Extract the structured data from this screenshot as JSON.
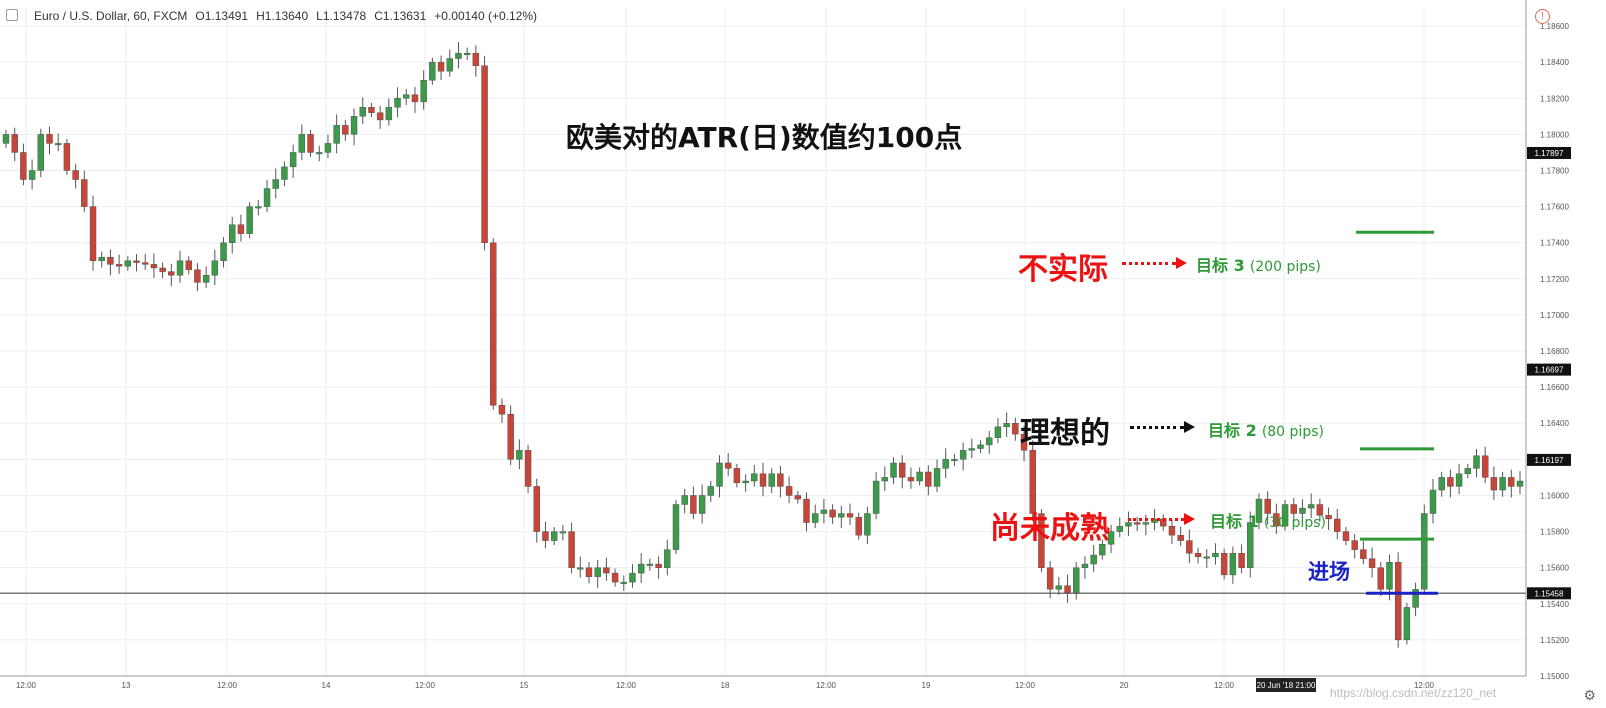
{
  "header": {
    "symbol": "Euro / U.S. Dollar, 60, FXCM",
    "ohlc": [
      "O1.13491",
      "H1.13640",
      "L1.13478",
      "C1.13631",
      "+0.00140 (+0.12%)"
    ]
  },
  "annotations": {
    "title": "欧美对的ATR(日)数值约100点",
    "unrealistic": "不实际",
    "ideal": "理想的",
    "premature": "尚未成熟",
    "entry": "进场",
    "target3_label": "目标 3",
    "target3_pips": "(200 pips)",
    "target2_label": "目标 2",
    "target2_pips": "(80 pips)",
    "target1_label": "目标 1",
    "target1_pips": "(30 pips)"
  },
  "watermark": "https://blog.csdn.net/zz120_net",
  "colors": {
    "up": "#3d9a4a",
    "down": "#c6463a",
    "target": "#2e9a36",
    "entry": "#1a22c4",
    "red_text": "#ee1111"
  },
  "chart_data": {
    "type": "candlestick",
    "ylim": [
      1.15,
      1.187
    ],
    "y_ticks": [
      "1.18600",
      "1.18400",
      "1.18200",
      "1.18000",
      "1.17800",
      "1.17600",
      "1.17400",
      "1.17200",
      "1.17000",
      "1.16800",
      "1.16600",
      "1.16400",
      "1.16200",
      "1.16000",
      "1.15800",
      "1.15600",
      "1.15400",
      "1.15200",
      "1.15000"
    ],
    "price_labels": [
      {
        "text": "1.17897",
        "value": 1.17897
      },
      {
        "text": "1.16697",
        "value": 1.16697
      },
      {
        "text": "1.16197",
        "value": 1.16197
      },
      {
        "text": "1.15458",
        "value": 1.15458
      }
    ],
    "x_ticks": [
      "12:00",
      "13",
      "12:00",
      "14",
      "12:00",
      "15",
      "12:00",
      "18",
      "12:00",
      "19",
      "12:00",
      "20",
      "12:00",
      "20 Jun '18  21:00",
      "12:00"
    ],
    "levels": {
      "entry": 1.15458,
      "target1": 1.15758,
      "target2": 1.16258,
      "target3": 1.17458
    },
    "closes": [
      1.18,
      1.179,
      1.1775,
      1.178,
      1.18,
      1.1795,
      1.1795,
      1.178,
      1.1775,
      1.176,
      1.173,
      1.1732,
      1.1728,
      1.1727,
      1.173,
      1.1729,
      1.1728,
      1.1726,
      1.1724,
      1.1722,
      1.173,
      1.1725,
      1.1718,
      1.1722,
      1.173,
      1.174,
      1.175,
      1.1745,
      1.176,
      1.176,
      1.177,
      1.1775,
      1.1782,
      1.179,
      1.18,
      1.179,
      1.179,
      1.1795,
      1.1805,
      1.18,
      1.181,
      1.1815,
      1.1812,
      1.1808,
      1.1815,
      1.182,
      1.1822,
      1.1818,
      1.183,
      1.184,
      1.1835,
      1.1842,
      1.1845,
      1.1845,
      1.1838,
      1.174,
      1.165,
      1.1645,
      1.162,
      1.1625,
      1.1605,
      1.158,
      1.1575,
      1.158,
      1.158,
      1.156,
      1.156,
      1.1555,
      1.156,
      1.1557,
      1.1552,
      1.1552,
      1.1557,
      1.1562,
      1.1562,
      1.156,
      1.157,
      1.1595,
      1.16,
      1.159,
      1.16,
      1.1605,
      1.1618,
      1.1615,
      1.1607,
      1.1608,
      1.1612,
      1.1605,
      1.1612,
      1.1605,
      1.16,
      1.1598,
      1.1585,
      1.159,
      1.1592,
      1.1588,
      1.159,
      1.1588,
      1.1578,
      1.159,
      1.1608,
      1.161,
      1.1618,
      1.161,
      1.1608,
      1.1613,
      1.1605,
      1.1615,
      1.162,
      1.162,
      1.1625,
      1.1626,
      1.1628,
      1.1632,
      1.1638,
      1.164,
      1.1634,
      1.1625,
      1.159,
      1.156,
      1.1548,
      1.155,
      1.1546,
      1.156,
      1.1562,
      1.1567,
      1.1573,
      1.158,
      1.1583,
      1.1585,
      1.1584,
      1.1585,
      1.1587,
      1.1583,
      1.1578,
      1.1575,
      1.1568,
      1.1566,
      1.1566,
      1.1568,
      1.1556,
      1.1568,
      1.156,
      1.1585,
      1.1598,
      1.159,
      1.1583,
      1.1595,
      1.159,
      1.1593,
      1.1595,
      1.1589,
      1.1587,
      1.158,
      1.1575,
      1.157,
      1.1565,
      1.156,
      1.1548,
      1.1563,
      1.152,
      1.1538,
      1.1548,
      1.159,
      1.1603,
      1.161,
      1.1605,
      1.1612,
      1.1615,
      1.1622,
      1.161,
      1.1603,
      1.161,
      1.1605,
      1.1608
    ]
  }
}
